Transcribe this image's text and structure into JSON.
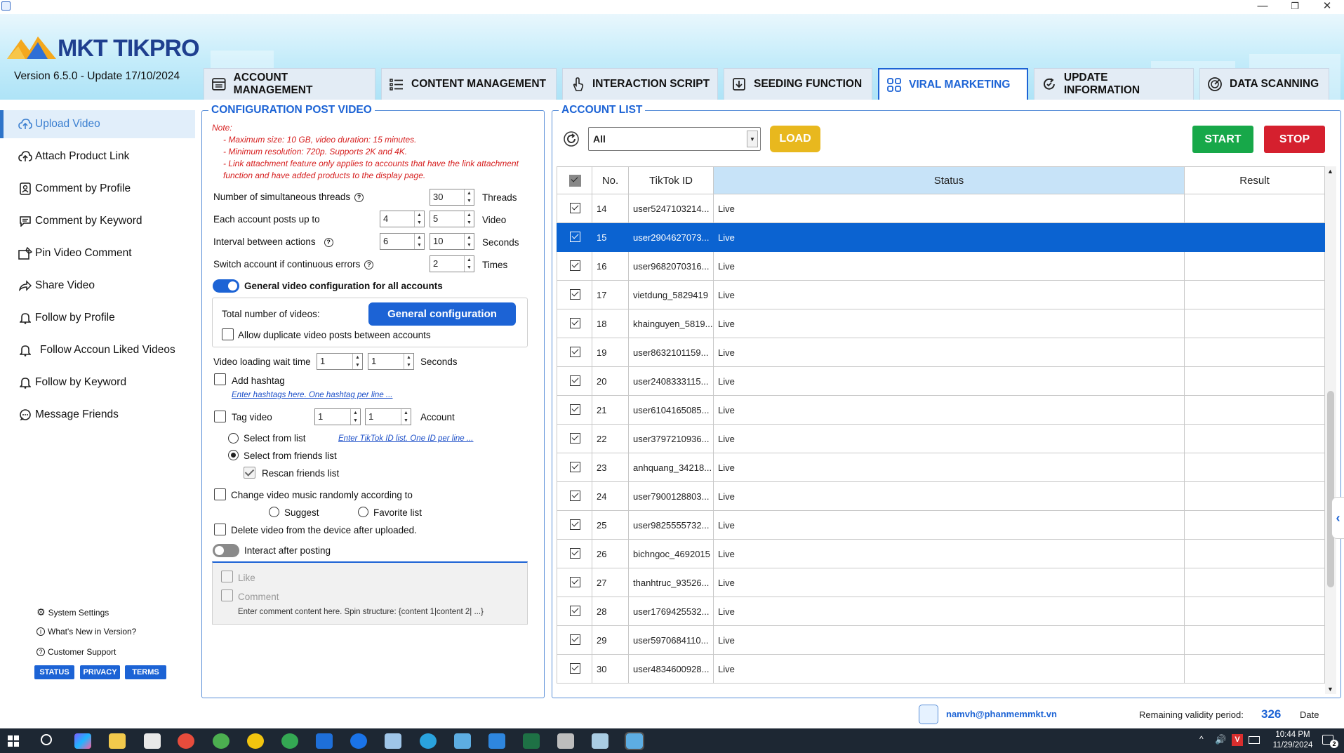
{
  "window": {
    "minimize": "—",
    "restore": "❐",
    "close": "✕"
  },
  "header": {
    "brand": "MKT TIKPRO",
    "version": "Version  6.5.0  - Update  17/10/2024",
    "tabs": [
      {
        "label": "ACCOUNT MANAGEMENT",
        "icon": "calendar-list-icon"
      },
      {
        "label": "CONTENT MANAGEMENT",
        "icon": "list-icon"
      },
      {
        "label": "INTERACTION SCRIPT",
        "icon": "hand-pointer-icon"
      },
      {
        "label": "SEEDING FUNCTION",
        "icon": "download-box-icon"
      },
      {
        "label": "VIRAL MARKETING",
        "icon": "grid-icon"
      },
      {
        "label": "UPDATE INFORMATION",
        "icon": "refresh-circle-icon"
      },
      {
        "label": "DATA SCANNING",
        "icon": "radar-icon"
      }
    ],
    "active_tab": "VIRAL MARKETING"
  },
  "sidebar": {
    "items": [
      {
        "label": "Upload Video",
        "icon": "cloud-upload-icon"
      },
      {
        "label": "Attach Product Link",
        "icon": "cloud-upload-icon"
      },
      {
        "label": "Comment by Profile",
        "icon": "profile-card-icon"
      },
      {
        "label": "Comment by Keyword",
        "icon": "comment-icon"
      },
      {
        "label": "Pin Video Comment",
        "icon": "pin-icon"
      },
      {
        "label": "Share Video",
        "icon": "share-icon"
      },
      {
        "label": "Follow by Profile",
        "icon": "bell-icon"
      },
      {
        "label": "Follow Accoun Liked Videos",
        "icon": "bell-icon"
      },
      {
        "label": "Follow by Keyword",
        "icon": "bell-icon"
      },
      {
        "label": "Message Friends",
        "icon": "message-icon"
      }
    ],
    "active_item": "Upload Video",
    "system_settings": "System Settings",
    "whats_new": "What's New in Version?",
    "customer_support": "Customer Support",
    "pills": [
      "STATUS",
      "PRIVACY",
      "TERMS"
    ]
  },
  "config": {
    "title": "CONFIGURATION POST VIDEO",
    "note_title": "Note:",
    "notes": [
      "- Maximum size: 10 GB, video duration: 15 minutes.",
      "- Minimum resolution: 720p. Supports 2K and 4K.",
      "- Link attachment feature only applies to accounts that have the link attachment",
      "function and have added products to the display page."
    ],
    "threads_label": "Number of simultaneous threads",
    "threads_value": "30",
    "threads_unit": "Threads",
    "posts_label": "Each account posts up to",
    "posts_min": "4",
    "posts_max": "5",
    "posts_unit": "Video",
    "interval_label": "Interval between actions",
    "interval_min": "6",
    "interval_max": "10",
    "interval_unit": "Seconds",
    "errors_label": "Switch account if continuous errors",
    "errors_value": "2",
    "errors_unit": "Times",
    "general_toggle_label": "General video configuration for all accounts",
    "general_toggle_on": true,
    "total_videos_label": "Total number of videos:",
    "general_config_button": "General configuration",
    "allow_duplicate_label": "Allow duplicate video posts between accounts",
    "allow_duplicate_checked": false,
    "wait_label": "Video loading wait time",
    "wait_min": "1",
    "wait_max": "1",
    "wait_unit": "Seconds",
    "add_hashtag_label": "Add hashtag",
    "add_hashtag_checked": false,
    "hashtag_link": "Enter hashtags here. One hashtag per line ...",
    "tag_video_label": "Tag video",
    "tag_video_checked": false,
    "tag_min": "1",
    "tag_max": "1",
    "tag_unit": "Account",
    "select_from_list": "Select from list",
    "select_from_list_selected": false,
    "tiktok_id_link": "Enter TikTok ID list. One ID per line ...",
    "select_from_friends": "Select from friends list",
    "select_from_friends_selected": true,
    "rescan_friends": "Rescan friends list",
    "rescan_friends_checked": true,
    "change_music_label": "Change video music randomly according to",
    "change_music_checked": false,
    "suggest": "Suggest",
    "favorite_list": "Favorite list",
    "delete_video_label": "Delete video from the device after uploaded.",
    "delete_video_checked": false,
    "interact_label": "Interact after posting",
    "interact_on": false,
    "like_label": "Like",
    "comment_label": "Comment",
    "comment_placeholder": "Enter comment content here. Spin structure: {content 1|content 2| ...}"
  },
  "accounts": {
    "title": "ACCOUNT LIST",
    "filter_value": "All",
    "load_button": "LOAD",
    "start_button": "START",
    "stop_button": "STOP",
    "columns": [
      "No.",
      "TikTok ID",
      "Status",
      "Result"
    ],
    "rows": [
      {
        "no": "14",
        "id": "user5247103214...",
        "status": "Live",
        "result": "",
        "selected": false
      },
      {
        "no": "15",
        "id": "user2904627073...",
        "status": "Live",
        "result": "",
        "selected": true
      },
      {
        "no": "16",
        "id": "user9682070316...",
        "status": "Live",
        "result": "",
        "selected": false
      },
      {
        "no": "17",
        "id": "vietdung_5829419",
        "status": "Live",
        "result": "",
        "selected": false
      },
      {
        "no": "18",
        "id": "khainguyen_5819...",
        "status": "Live",
        "result": "",
        "selected": false
      },
      {
        "no": "19",
        "id": "user8632101159...",
        "status": "Live",
        "result": "",
        "selected": false
      },
      {
        "no": "20",
        "id": "user2408333115...",
        "status": "Live",
        "result": "",
        "selected": false
      },
      {
        "no": "21",
        "id": "user6104165085...",
        "status": "Live",
        "result": "",
        "selected": false
      },
      {
        "no": "22",
        "id": "user3797210936...",
        "status": "Live",
        "result": "",
        "selected": false
      },
      {
        "no": "23",
        "id": "anhquang_34218...",
        "status": "Live",
        "result": "",
        "selected": false
      },
      {
        "no": "24",
        "id": "user7900128803...",
        "status": "Live",
        "result": "",
        "selected": false
      },
      {
        "no": "25",
        "id": "user9825555732...",
        "status": "Live",
        "result": "",
        "selected": false
      },
      {
        "no": "26",
        "id": "bichngoc_4692015",
        "status": "Live",
        "result": "",
        "selected": false
      },
      {
        "no": "27",
        "id": "thanhtruc_93526...",
        "status": "Live",
        "result": "",
        "selected": false
      },
      {
        "no": "28",
        "id": "user1769425532...",
        "status": "Live",
        "result": "",
        "selected": false
      },
      {
        "no": "29",
        "id": "user5970684110...",
        "status": "Live",
        "result": "",
        "selected": false
      },
      {
        "no": "30",
        "id": "user4834600928...",
        "status": "Live",
        "result": "",
        "selected": false
      }
    ]
  },
  "footer": {
    "email": "namvh@phanmemmkt.vn",
    "validity_label": "Remaining validity period:",
    "validity_value": "326",
    "date_label": "Date"
  },
  "taskbar": {
    "time": "10:44 PM",
    "date": "11/29/2024",
    "notification_count": "2"
  },
  "colors": {
    "accent": "#1c63d5",
    "load": "#e8b81e",
    "start": "#17a849",
    "stop": "#d5202e",
    "note": "#d62020",
    "selected_row": "#0b63d1"
  }
}
